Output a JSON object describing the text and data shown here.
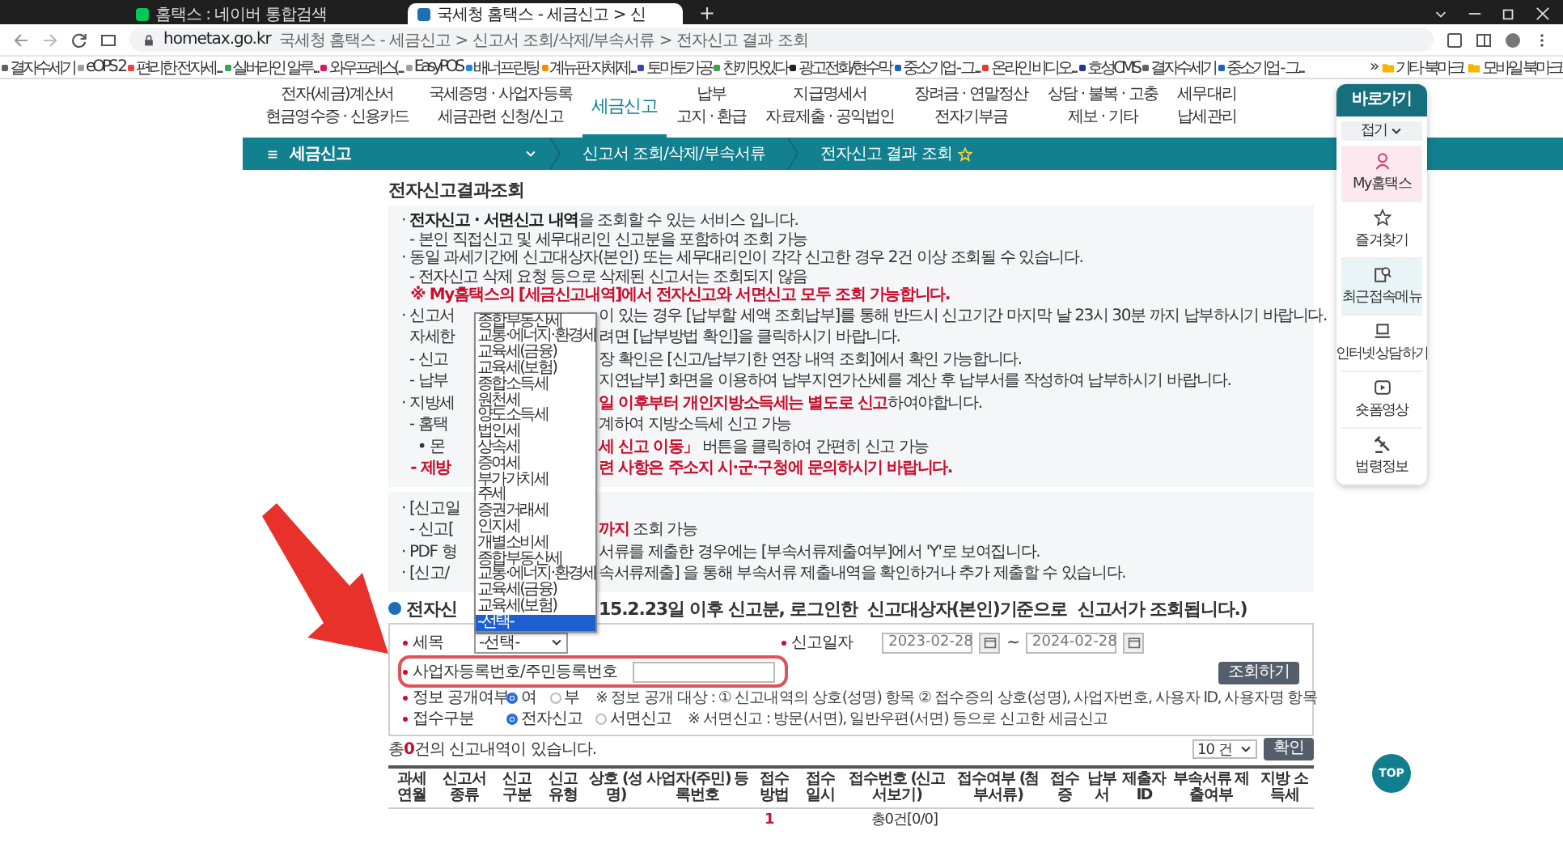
{
  "browser": {
    "tabs": [
      {
        "title": "홈택스 : 네이버 통합검색",
        "selected": false
      },
      {
        "title": "국세청 홈택스 - 세금신고 > 신",
        "selected": true
      }
    ],
    "new_tab": "+",
    "address": {
      "domain": "hometax.go.kr",
      "path": "국세청 홈택스 - 세금신고 > 신고서 조회/삭제/부속서류 > 전자신고 결과 조회"
    },
    "bookmarks": [
      {
        "label": "결자수세기",
        "color": "#5f6368"
      },
      {
        "label": "eOPS 2",
        "color": "#9aa0a6"
      },
      {
        "label": "편리한 전자세...",
        "color": "#e8453c"
      },
      {
        "label": "실버라인 알루...",
        "color": "#34a853"
      },
      {
        "label": "와우프레스(...",
        "color": "#d81b60"
      },
      {
        "label": "EasyPOS",
        "color": "#9aa0a6"
      },
      {
        "label": "배너프린팅",
        "color": "#1e88e5"
      },
      {
        "label": "계뉴판 자체제...",
        "color": "#fb8c00"
      },
      {
        "label": "토마토가공",
        "color": "#3949ab"
      },
      {
        "label": "찬끼맛있다",
        "color": "#43a047"
      },
      {
        "label": "광고전화/현수막",
        "color": "#202124"
      },
      {
        "label": "중소기업 - 그...",
        "color": "#1565c0"
      },
      {
        "label": "온라인 비디오...",
        "color": "#e53935"
      },
      {
        "label": "호성CMS",
        "color": "#283593"
      },
      {
        "label": "결자수세기",
        "color": "#5f6368"
      },
      {
        "label": "중소기업 - 그...",
        "color": "#1565c0"
      }
    ],
    "more": "»",
    "folders": [
      "기타 북마크",
      "모바일 북마크"
    ]
  },
  "nav": [
    {
      "lines": [
        "전자(세금)계산서",
        "현금영수증 · 신용카드"
      ],
      "selected": false
    },
    {
      "lines": [
        "국세증명 · 사업자등록",
        "세금관련 신청/신고"
      ],
      "selected": false
    },
    {
      "lines": [
        "세금신고"
      ],
      "selected": true
    },
    {
      "lines": [
        "납부",
        "고지 · 환급"
      ],
      "selected": false
    },
    {
      "lines": [
        "지급명세서",
        "자료제출 · 공익법인"
      ],
      "selected": false
    },
    {
      "lines": [
        "장려금 · 연말정산",
        "전자기부금"
      ],
      "selected": false
    },
    {
      "lines": [
        "상담 · 불복 · 고충",
        "제보 · 기타"
      ],
      "selected": false
    },
    {
      "lines": [
        "세무대리",
        "납세관리"
      ],
      "selected": false
    }
  ],
  "menu_bar": {
    "menu": "세금신고",
    "crumbs": [
      "신고서 조회/삭제/부속서류",
      "전자신고 결과 조회"
    ]
  },
  "page_title": "전자신고결과조회",
  "notice_boxes": [
    {
      "lines": [
        {
          "kind": "plain",
          "text": "· **전자신고 · 서면신고 내역**을 조회할 수 있는 서비스 입니다."
        },
        {
          "kind": "plain",
          "text": "  - 본인 직접신고 및 세무대리인 신고분을 포함하여 조회 가능"
        },
        {
          "kind": "plain",
          "text": "· 동일 과세기간에 신고대상자(본인) 또는 세무대리인이 각각 신고한 경우 2건 이상 조회될 수 있습니다."
        },
        {
          "kind": "plain",
          "text": "  - 전자신고 삭제 요청 등으로 삭제된 신고서는 조회되지 않음"
        },
        {
          "kind": "alert",
          "text": "  ※ My홈택스의 [세금신고내역]에서 전자신고와 서면신고 모두 조회 가능합니다."
        },
        {
          "kind": "plain",
          "left": "· 신고서",
          "right": "이 있는 경우 [납부할 세액 조회납부]를 통해 반드시 신고기간 마지막 날 23시 30분 까지 납부하시기 바랍니다."
        },
        {
          "kind": "plain",
          "left": "  자세한",
          "right": "려면 [납부방법 확인]을 클릭하시기 바랍니다."
        },
        {
          "kind": "plain",
          "left": "  - 신고",
          "right": "장 확인은 [신고/납부기한 연장 내역 조회]에서 확인 가능합니다."
        },
        {
          "kind": "plain",
          "left": "  - 납부",
          "right": "지연납부] 화면을 이용하여 납부지연가산세를 계산 후 납부서를 작성하여 납부하시기 바랍니다."
        },
        {
          "kind": "red-em",
          "left": "· 지방세",
          "right": "**일 이후부터 개인지방소득세는 별도로 신고**하여야합니다."
        },
        {
          "kind": "plain",
          "left": "  - 홈택",
          "right": "계하여 지방소득세 신고 가능"
        },
        {
          "kind": "red-em",
          "left": "    • 몬",
          "right": "**세 신고 이동」** 버튼을 클릭하여 간편히 신고 가능"
        },
        {
          "kind": "alert",
          "left": "  - 제방",
          "right": "련 사항은 주소지 시·군·구청에 문의하시기 바랍니다."
        }
      ]
    },
    {
      "lines": [
        {
          "kind": "plain",
          "left": "· [신고일"
        },
        {
          "kind": "red-em",
          "left": "  - 신고[",
          "right": "**까지** 조회 가능"
        },
        {
          "kind": "plain",
          "left": "· PDF 형",
          "right": "서류를 제출한 경우에는 [부속서류제출여부]에서 'Y'로 보여집니다."
        },
        {
          "kind": "plain",
          "left": "· [신고/",
          "right": "속서류제출] 을 통해 부속서류 제출내역을 확인하거나 추가 제출할 수 있습니다."
        }
      ]
    }
  ],
  "section_heading": {
    "left": "전자신",
    "right": "15.2.23일 이후 신고분, 로그인한  신고대상자(본인)기준으로  신고서가 조회됩니다.)"
  },
  "form": {
    "tax_item": {
      "label": "세목",
      "value": "-선택-",
      "options": [
        {
          "label": "종합부동산세",
          "selected": false
        },
        {
          "label": "교통·에너지·환경세",
          "selected": false
        },
        {
          "label": "교육세(금융)",
          "selected": false
        },
        {
          "label": "교육세(보험)",
          "selected": false
        },
        {
          "label": "종합소득세",
          "selected": false
        },
        {
          "label": "원천세",
          "selected": false
        },
        {
          "label": "양도소득세",
          "selected": false
        },
        {
          "label": "법인세",
          "selected": false
        },
        {
          "label": "상속세",
          "selected": false
        },
        {
          "label": "증여세",
          "selected": false
        },
        {
          "label": "부가가치세",
          "selected": false
        },
        {
          "label": "주세",
          "selected": false
        },
        {
          "label": "증권거래세",
          "selected": false
        },
        {
          "label": "인지세",
          "selected": false
        },
        {
          "label": "개별소비세",
          "selected": false
        },
        {
          "label": "종합부동산세",
          "selected": false
        },
        {
          "label": "교통·에너지·환경세",
          "selected": false
        },
        {
          "label": "교육세(금융)",
          "selected": false
        },
        {
          "label": "교육세(보험)",
          "selected": false
        },
        {
          "label": "-선택-",
          "selected": true
        }
      ]
    },
    "date": {
      "label": "신고일자",
      "from": "2023-02-28",
      "separator": "~",
      "to": "2024-02-28"
    },
    "id_number": {
      "label": "사업자등록번호/주민등록번호"
    },
    "search_button": "조회하기",
    "disclosure": {
      "label": "정보 공개여부",
      "options": [
        {
          "label": "여",
          "selected": true
        },
        {
          "label": "부",
          "selected": false
        }
      ],
      "note": "※ 정보 공개 대상 : ① 신고내역의 상호(성명) 항목 ② 접수증의 상호(성명), 사업자번호, 사용자 ID, 사용자명 항목"
    },
    "receipt_type": {
      "label": "접수구분",
      "options": [
        {
          "label": "전자신고",
          "selected": true
        },
        {
          "label": "서면신고",
          "selected": false
        }
      ],
      "note": "※ 서면신고 : 방문(서면), 일반우편(서면) 등으로 신고한 세금신고"
    }
  },
  "results": {
    "summary": "총**0**건의 신고내역이 있습니다.",
    "page_size": "10 건",
    "confirm_button": "확인"
  },
  "table": {
    "columns": [
      "과세연월",
      "신고서 종류",
      "신고구분",
      "신고유형",
      "상호 (성명)",
      "사업자(주민) 등록번호",
      "접수방법",
      "접수일시",
      "접수번호 (신고서보기)",
      "접수여부 (첨부서류)",
      "접수증",
      "납부서",
      "제출자ID",
      "부속서류 제출여부",
      "지방 소득세"
    ]
  },
  "pagination": {
    "pages": [
      {
        "label": "1",
        "selected": true
      }
    ],
    "total": "총0건[0/0]"
  },
  "sidebar": {
    "title": "바로가기",
    "collapse": "접기",
    "items": [
      {
        "label": "My홈택스",
        "color": "#fbe9ef"
      },
      {
        "label": "즐겨찾기",
        "color": "#ffffff"
      },
      {
        "label": "최근접속메뉴",
        "color": "#e8f4f5"
      },
      {
        "label": "인터넷상담하기",
        "color": "#ffffff"
      },
      {
        "label": "숏폼영상",
        "color": "#ffffff"
      },
      {
        "label": "법령정보",
        "color": "#ffffff"
      }
    ]
  },
  "top_button": "TOP"
}
